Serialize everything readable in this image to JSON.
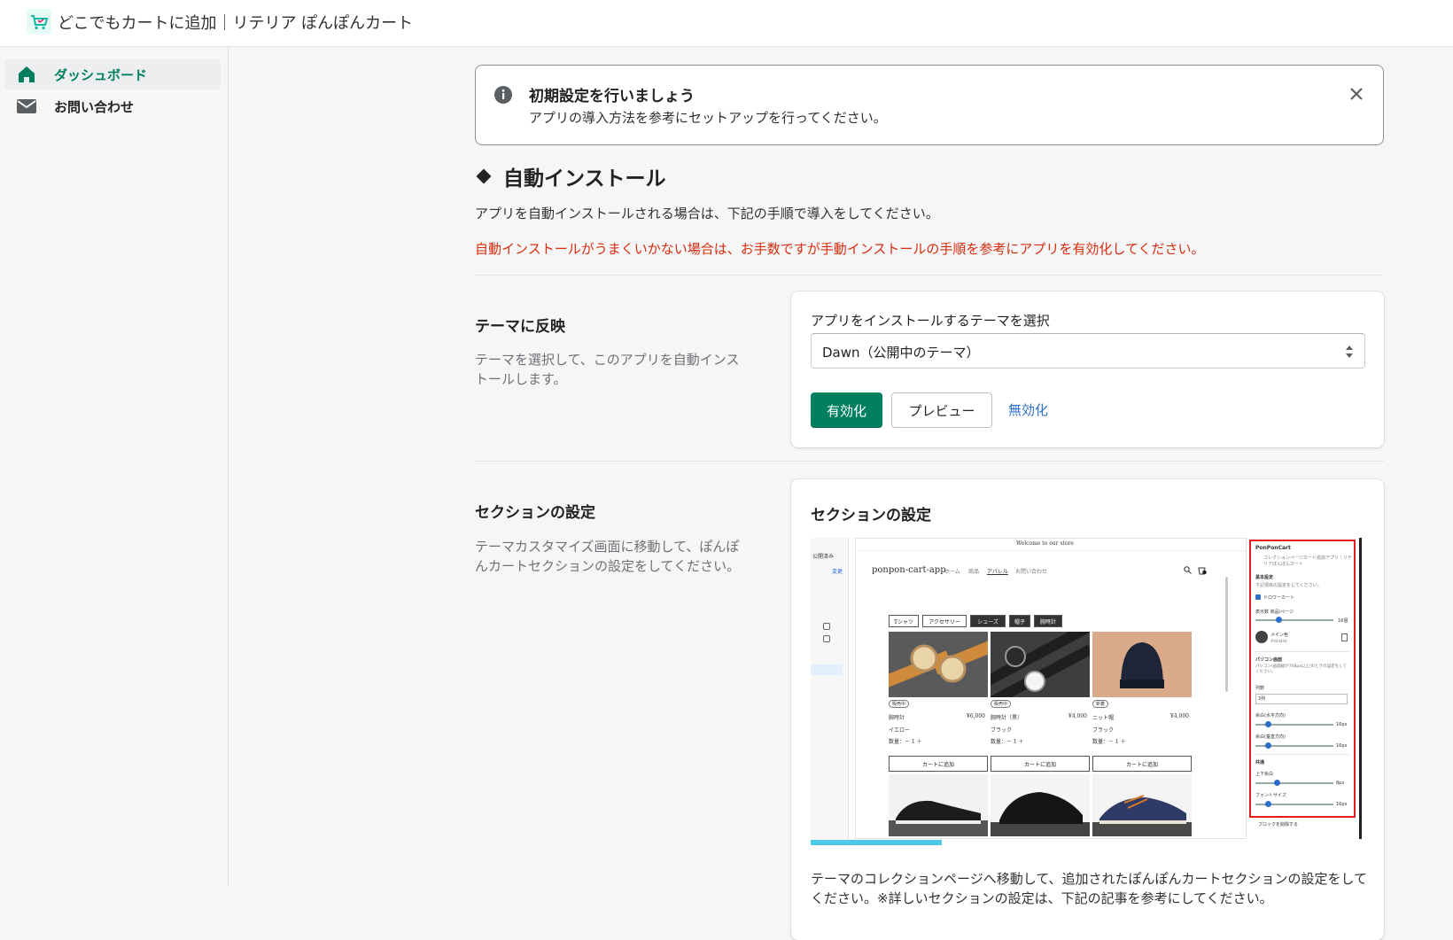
{
  "header": {
    "app_title": "どこでもカートに追加｜リテリア ぽんぽんカート"
  },
  "sidebar": {
    "items": [
      {
        "label": "ダッシュボード",
        "icon": "home-icon",
        "active": true
      },
      {
        "label": "お問い合わせ",
        "icon": "mail-icon",
        "active": false
      }
    ]
  },
  "banner": {
    "title": "初期設定を行いましょう",
    "text": "アプリの導入方法を参考にセットアップを行ってください。"
  },
  "auto_install": {
    "heading": "自動インストール",
    "description": "アプリを自動インストールされる場合は、下記の手順で導入をしてください。",
    "warning": "自動インストールがうまくいかない場合は、お手数ですが手動インストールの手順を参考にアプリを有効化してください。"
  },
  "theme_section": {
    "title": "テーマに反映",
    "description": "テーマを選択して、このアプリを自動インストールします。",
    "select_label": "アプリをインストールするテーマを選択",
    "selected_theme": "Dawn（公開中のテーマ）",
    "enable_button": "有効化",
    "preview_button": "プレビュー",
    "disable_link": "無効化"
  },
  "section_settings": {
    "title": "セクションの設定",
    "description": "テーマカスタマイズ画面に移動して、ぽんぽんカートセクションの設定をしてください。",
    "card_title": "セクションの設定",
    "card_text": "テーマのコレクションページへ移動して、追加されたぽんぽんカートセクションの設定をしてください。※詳しいセクションの設定は、下記の記事を参考にしてください。",
    "screenshot": {
      "store_banner": "Welcome to our store",
      "store_name": "ponpon-cart-app",
      "nav": [
        "ホーム",
        "商品",
        "アパレル",
        "お問い合わせ"
      ],
      "tabs": [
        "Tシャツ",
        "アクセサリー",
        "シューズ",
        "帽子",
        "腕時計"
      ],
      "products": [
        {
          "name": "腕時計",
          "price": "¥6,000",
          "variant": "イエロー",
          "badge": "販売中"
        },
        {
          "name": "腕時計（黒）",
          "price": "¥4,000",
          "variant": "ブラック",
          "badge": "販売中"
        },
        {
          "name": "ニット帽",
          "price": "¥4,000",
          "variant": "ブラック",
          "badge": "新着"
        }
      ],
      "qty_label": "数量：－ 1 ＋",
      "add_to_cart": "カートに追加",
      "left_labels": [
        "公開済み",
        "変更"
      ],
      "panel": {
        "title": "PonPonCart",
        "subtitle": "コレクションページカート追加アプリ｜リテリアぽんぽんカート",
        "group_basic": "基本設定",
        "basic_note": "下記項目の設定をしてください。",
        "drawer_cart": "ドロワーカート",
        "items_per_page": "表示数 商品/ページ",
        "items_value": "16個",
        "main_color": "メイン色",
        "main_hex": "#444444",
        "pc_label": "パソコン画面",
        "pc_note": "パソコン(画面幅が768px以上)のときの設定をしてください。",
        "columns_label": "列数",
        "columns_value": "3列",
        "h_margin": "余白(水平方向)",
        "h_value": "16px",
        "v_margin": "余白(垂直方向)",
        "v_value": "16px",
        "shared": "共通",
        "top_bottom": "上下余白",
        "tb_value": "8px",
        "font_size": "フォントサイズ",
        "fs_value": "16px",
        "delete_block": "ブロックを削除する"
      }
    }
  },
  "colors": {
    "primary": "#008060",
    "link": "#2c6ecb",
    "warning": "#d72c0d",
    "highlight": "#e02020"
  }
}
